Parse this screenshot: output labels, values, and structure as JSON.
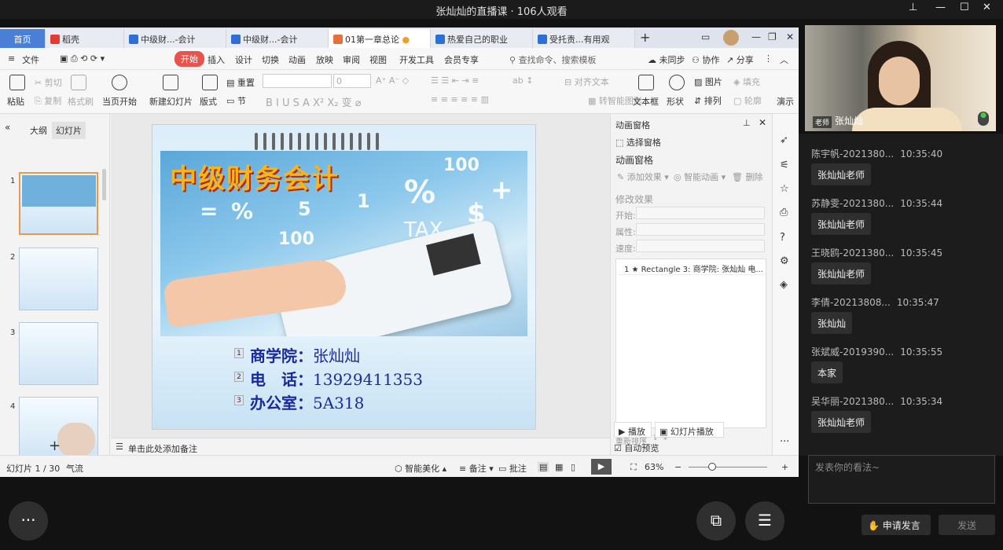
{
  "stream": {
    "title": "张灿灿的直播课 · 106人观看"
  },
  "tabs": [
    "首页",
    "稻壳",
    "中级财...-会计",
    "中级财...-会计",
    "01第一章总论",
    "热爱自己的职业",
    "受托责...有用观"
  ],
  "menu": {
    "file": "文件",
    "items": [
      "开始",
      "插入",
      "设计",
      "切换",
      "动画",
      "放映",
      "审阅",
      "视图",
      "开发工具",
      "会员专享"
    ],
    "search": "查找命令、搜索模板",
    "sync": "未同步",
    "collab": "协作",
    "share": "分享"
  },
  "ribbon": {
    "paste": "粘贴",
    "cut": "剪切",
    "copy": "复制",
    "format": "格式刷",
    "play_current": "当页开始",
    "new_slide": "新建幻灯片",
    "layout": "版式",
    "section": "节",
    "reset": "重置",
    "font_size": "0",
    "align_text": "对齐文本",
    "convert": "转智能图形",
    "textbox": "文本框",
    "shape": "形状",
    "picture": "图片",
    "arrange": "排列",
    "fill": "填充",
    "outline": "轮廓",
    "present": "演示"
  },
  "left_panel": {
    "tab_outline": "大纲",
    "tab_slides": "幻灯片",
    "slides": [
      "1",
      "2",
      "3",
      "4"
    ]
  },
  "slide": {
    "title": "中级财务会计",
    "rows": [
      {
        "n": "1",
        "label": "商学院：",
        "value": "张灿灿"
      },
      {
        "n": "2",
        "label": "电　话：",
        "value": "13929411353"
      },
      {
        "n": "3",
        "label": "办公室：",
        "value": "5A318"
      }
    ],
    "numbers": [
      "100",
      "%",
      "$",
      "TAX",
      "100",
      "%",
      "5",
      "+",
      "=",
      "1"
    ]
  },
  "notes": {
    "placeholder": "单击此处添加备注"
  },
  "right_panel": {
    "title": "动画窗格",
    "select_pane": "选择窗格",
    "anim_pane": "动画窗格",
    "add_effect": "添加效果",
    "smart_anim": "智能动画",
    "delete": "删除",
    "modify": "修改效果",
    "start": "开始:",
    "property": "属性:",
    "speed": "速度:",
    "item": "1 ★ Rectangle 3: 商学院: 张灿灿 电...",
    "reorder": "重新排序",
    "play": "播放",
    "slideshow": "幻灯片播放",
    "autopreview": "自动预览"
  },
  "status": {
    "slide": "幻灯片 1 / 30",
    "theme": "气流",
    "smart": "智能美化",
    "notes": "备注",
    "comment": "批注",
    "zoom": "63%"
  },
  "video": {
    "role": "老师",
    "name": "张灿灿"
  },
  "chat": [
    {
      "name": "陈宇帆-2021380...",
      "time": "10:35:40",
      "msg": "张灿灿老师"
    },
    {
      "name": "苏静雯-2021380...",
      "time": "10:35:44",
      "msg": "张灿灿老师"
    },
    {
      "name": "王晓鸥-2021380...",
      "time": "10:35:45",
      "msg": "张灿灿老师"
    },
    {
      "name": "李倩-20213808...",
      "time": "10:35:47",
      "msg": "张灿灿"
    },
    {
      "name": "张斌威-2019390...",
      "time": "10:35:55",
      "msg": "本家"
    },
    {
      "name": "吴华丽-2021380...",
      "time": "10:35:34",
      "msg": "张灿灿老师"
    }
  ],
  "input": {
    "placeholder": "发表你的看法~",
    "apply": "申请发言",
    "send": "发送"
  },
  "colors": {
    "accent": "#e8544c",
    "home_tab": "#4a7fd8",
    "title_orange": "#f7b51c",
    "slide_text": "#1a2a9a"
  }
}
